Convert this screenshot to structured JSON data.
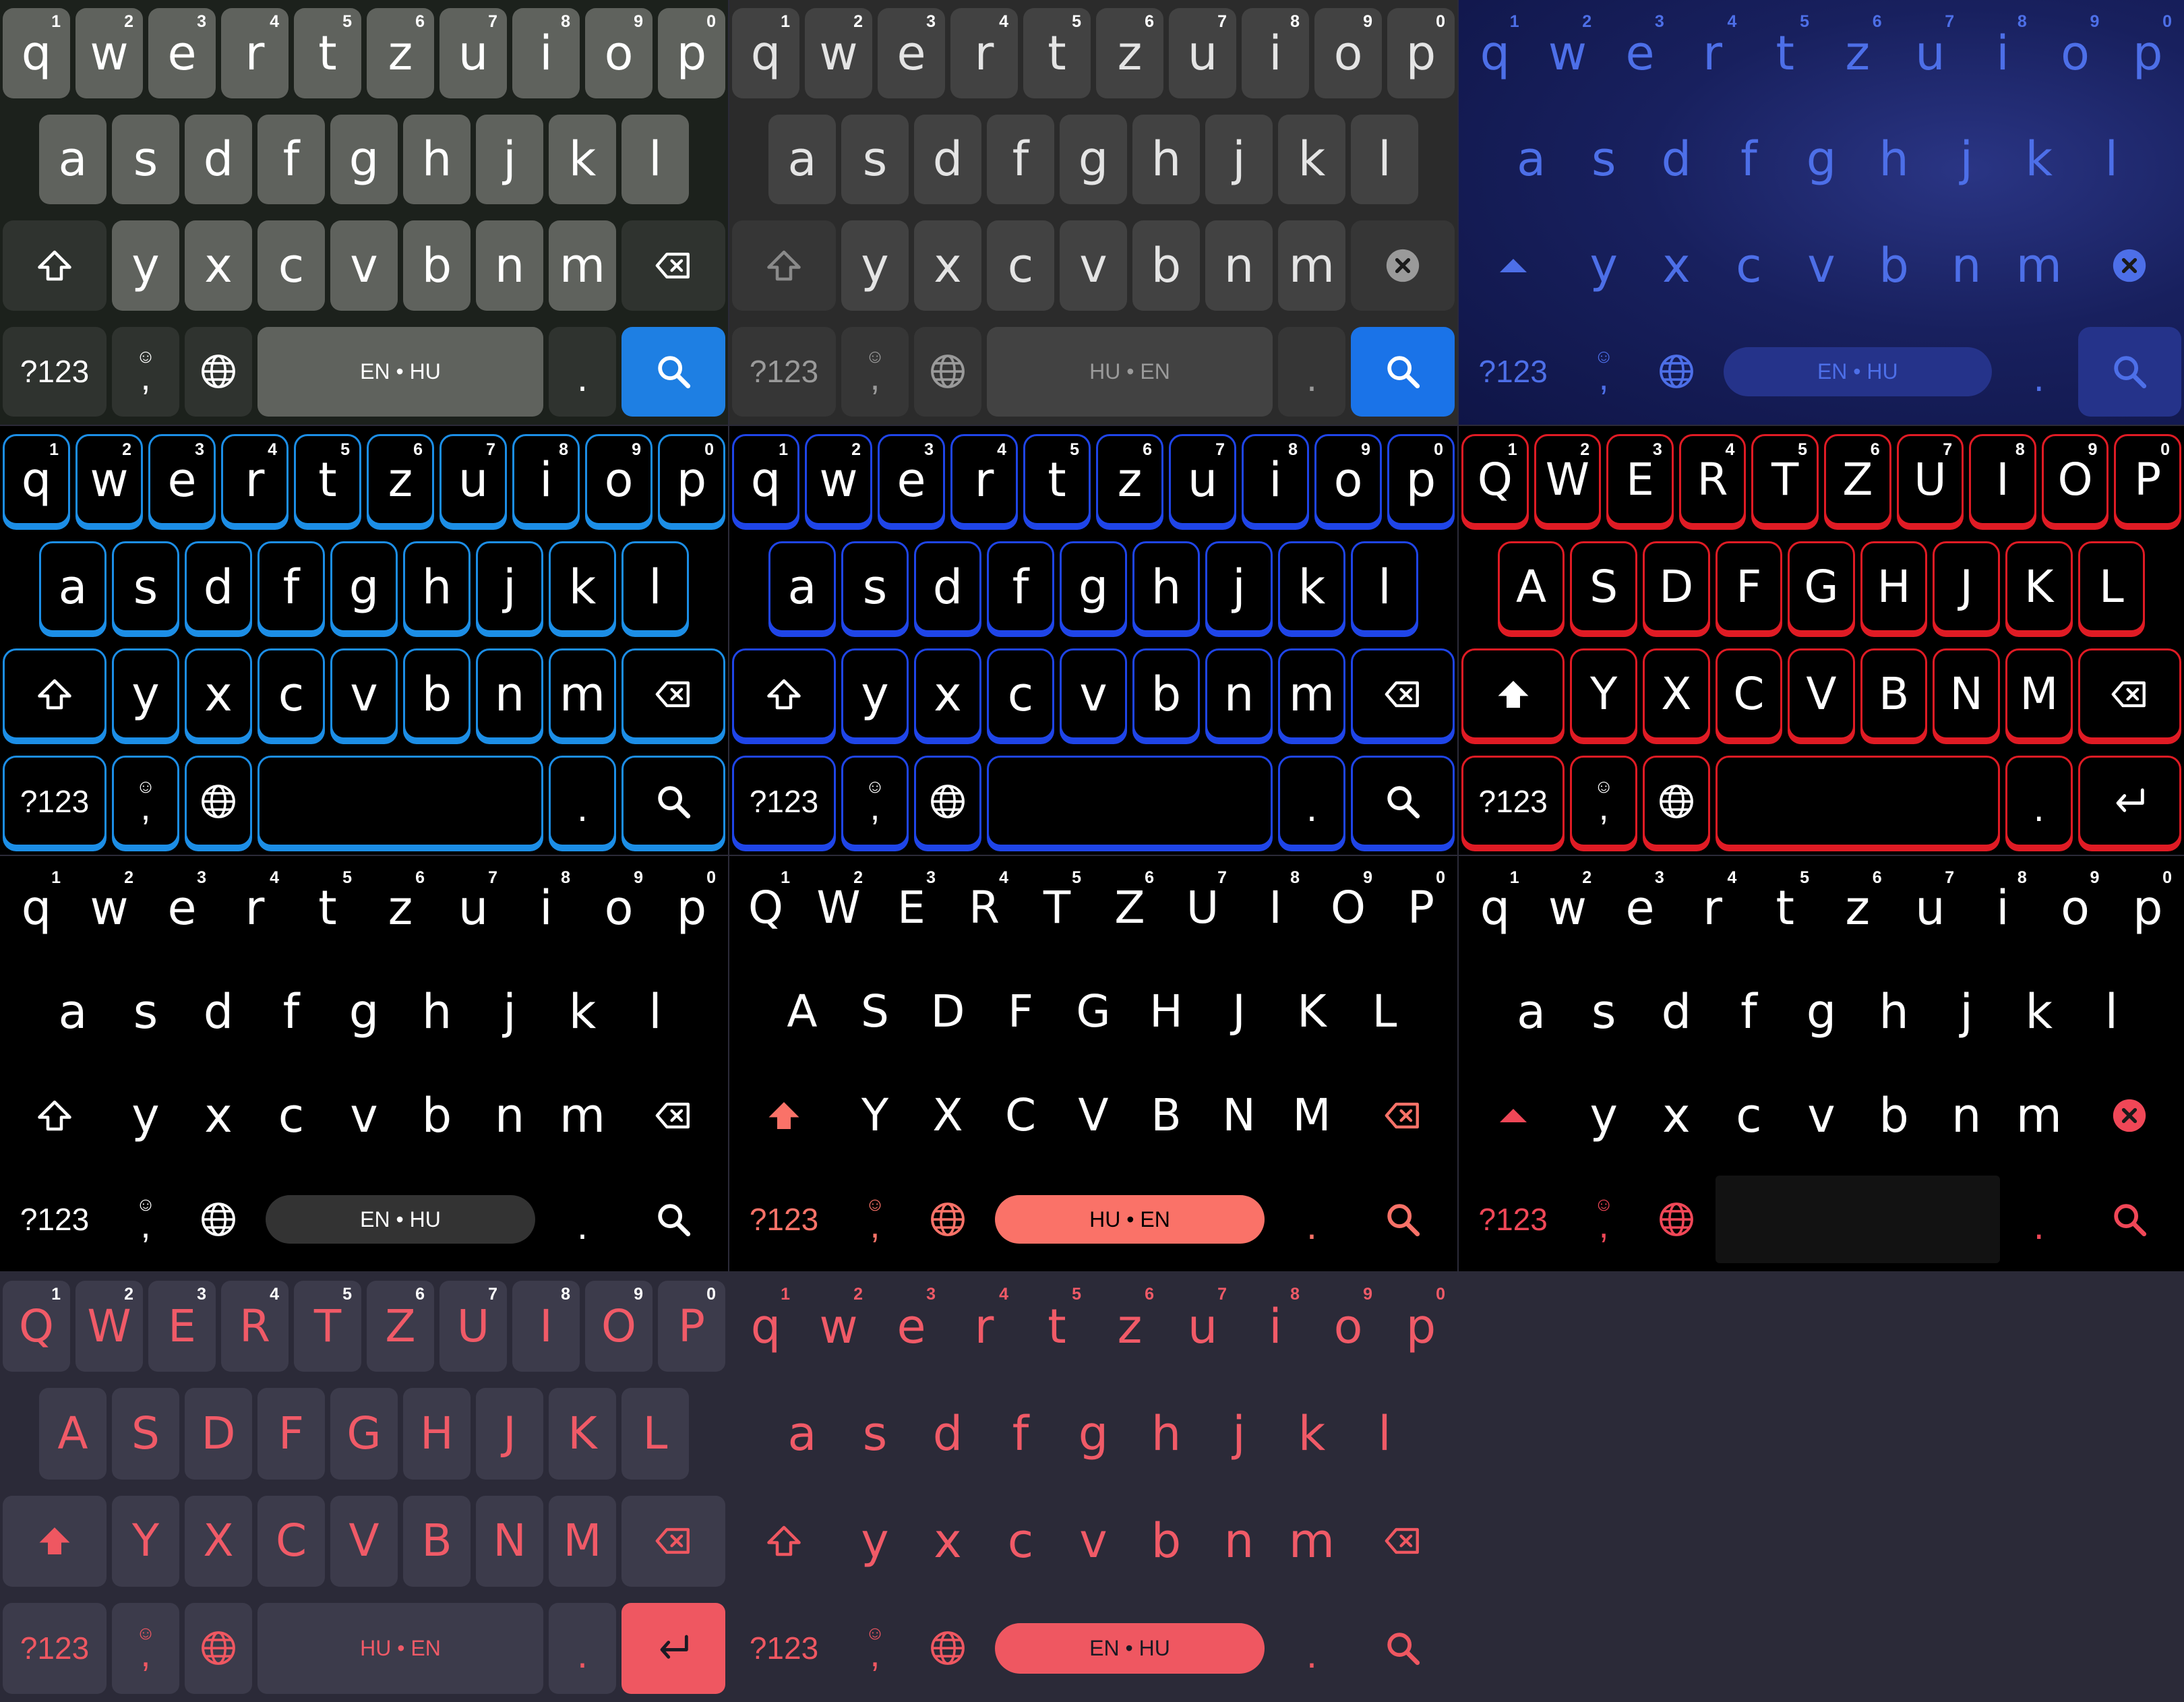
{
  "layout": {
    "number_hints": [
      "1",
      "2",
      "3",
      "4",
      "5",
      "6",
      "7",
      "8",
      "9",
      "0"
    ],
    "row1": [
      "q",
      "w",
      "e",
      "r",
      "t",
      "z",
      "u",
      "i",
      "o",
      "p"
    ],
    "row2": [
      "a",
      "s",
      "d",
      "f",
      "g",
      "h",
      "j",
      "k",
      "l"
    ],
    "row3": [
      "y",
      "x",
      "c",
      "v",
      "b",
      "n",
      "m"
    ],
    "symbols_label": "?123",
    "period_label": ".",
    "emoji_comma_label": ","
  },
  "icons": {
    "shift": "shift-icon",
    "shift_filled": "shift-filled-icon",
    "backspace": "backspace-icon",
    "emoji": "emoji-icon",
    "globe": "globe-icon",
    "search": "search-icon",
    "enter": "enter-icon"
  },
  "themes": [
    {
      "name": "gray-keys-green-dark",
      "bg": "#1c211c",
      "key_fill": "#5f625d",
      "fn_fill": "#2f332f",
      "text": "#ffffff",
      "accent": "#1e7fe3",
      "uppercase": false,
      "show_numbers": true,
      "space_label": "EN • HU",
      "action": "search",
      "borders": false
    },
    {
      "name": "charcoal",
      "bg": "#2b2b2b",
      "key_fill": "#424242",
      "fn_fill": "#363636",
      "text": "#e4e4e4",
      "accent": "#1a73e8",
      "uppercase": false,
      "show_numbers": true,
      "space_label": "HU • EN",
      "action": "search",
      "borders": false
    },
    {
      "name": "starry-night",
      "bg": "#141a52",
      "key_fill": "transparent",
      "fn_fill": "transparent",
      "text": "#4d6fe8",
      "accent": "#25338a",
      "uppercase": false,
      "show_numbers": true,
      "space_label": "EN • HU",
      "action": "search",
      "borders": false
    },
    {
      "name": "neon-sky-blue",
      "bg": "#000000",
      "key_fill": "#000000",
      "fn_fill": "#000000",
      "text": "#ffffff",
      "accent": "#1c8ee6",
      "uppercase": false,
      "show_numbers": true,
      "space_label": "",
      "action": "search",
      "borders": true
    },
    {
      "name": "neon-royal-blue",
      "bg": "#000000",
      "key_fill": "#000000",
      "fn_fill": "#000000",
      "text": "#ffffff",
      "accent": "#1f45e8",
      "uppercase": false,
      "show_numbers": true,
      "space_label": "",
      "action": "search",
      "borders": true
    },
    {
      "name": "neon-red",
      "bg": "#000000",
      "key_fill": "#000000",
      "fn_fill": "#000000",
      "text": "#ffffff",
      "accent": "#e01b24",
      "uppercase": true,
      "show_numbers": true,
      "space_label": "",
      "action": "enter",
      "borders": true
    },
    {
      "name": "black-flat",
      "bg": "#000000",
      "key_fill": "transparent",
      "fn_fill": "transparent",
      "text": "#ffffff",
      "accent": "#333333",
      "uppercase": false,
      "show_numbers": true,
      "space_label": "EN • HU",
      "action": "search",
      "borders": false
    },
    {
      "name": "black-caps-coral",
      "bg": "#000000",
      "key_fill": "transparent",
      "fn_fill": "transparent",
      "text": "#ffffff",
      "accent": "#fa7268",
      "uppercase": true,
      "show_numbers": true,
      "space_label": "HU • EN",
      "action": "search",
      "borders": false
    },
    {
      "name": "black-red-accent",
      "bg": "#000000",
      "key_fill": "transparent",
      "fn_fill": "transparent",
      "text": "#ffffff",
      "accent": "#f04757",
      "uppercase": false,
      "show_numbers": true,
      "space_label": "",
      "action": "search",
      "borders": false
    },
    {
      "name": "slate-coral-caps",
      "bg": "#2b2a38",
      "key_fill": "#3c3b4b",
      "fn_fill": "#3c3b4b",
      "text": "#f05a67",
      "accent": "#ef5761",
      "uppercase": true,
      "show_numbers": true,
      "space_label": "HU • EN",
      "action": "enter",
      "borders": false
    },
    {
      "name": "slate-coral-flat",
      "bg": "#2b2a38",
      "key_fill": "transparent",
      "fn_fill": "transparent",
      "text": "#f05a67",
      "accent": "#ef5761",
      "uppercase": false,
      "show_numbers": true,
      "space_label": "EN • HU",
      "action": "search",
      "borders": false
    }
  ]
}
